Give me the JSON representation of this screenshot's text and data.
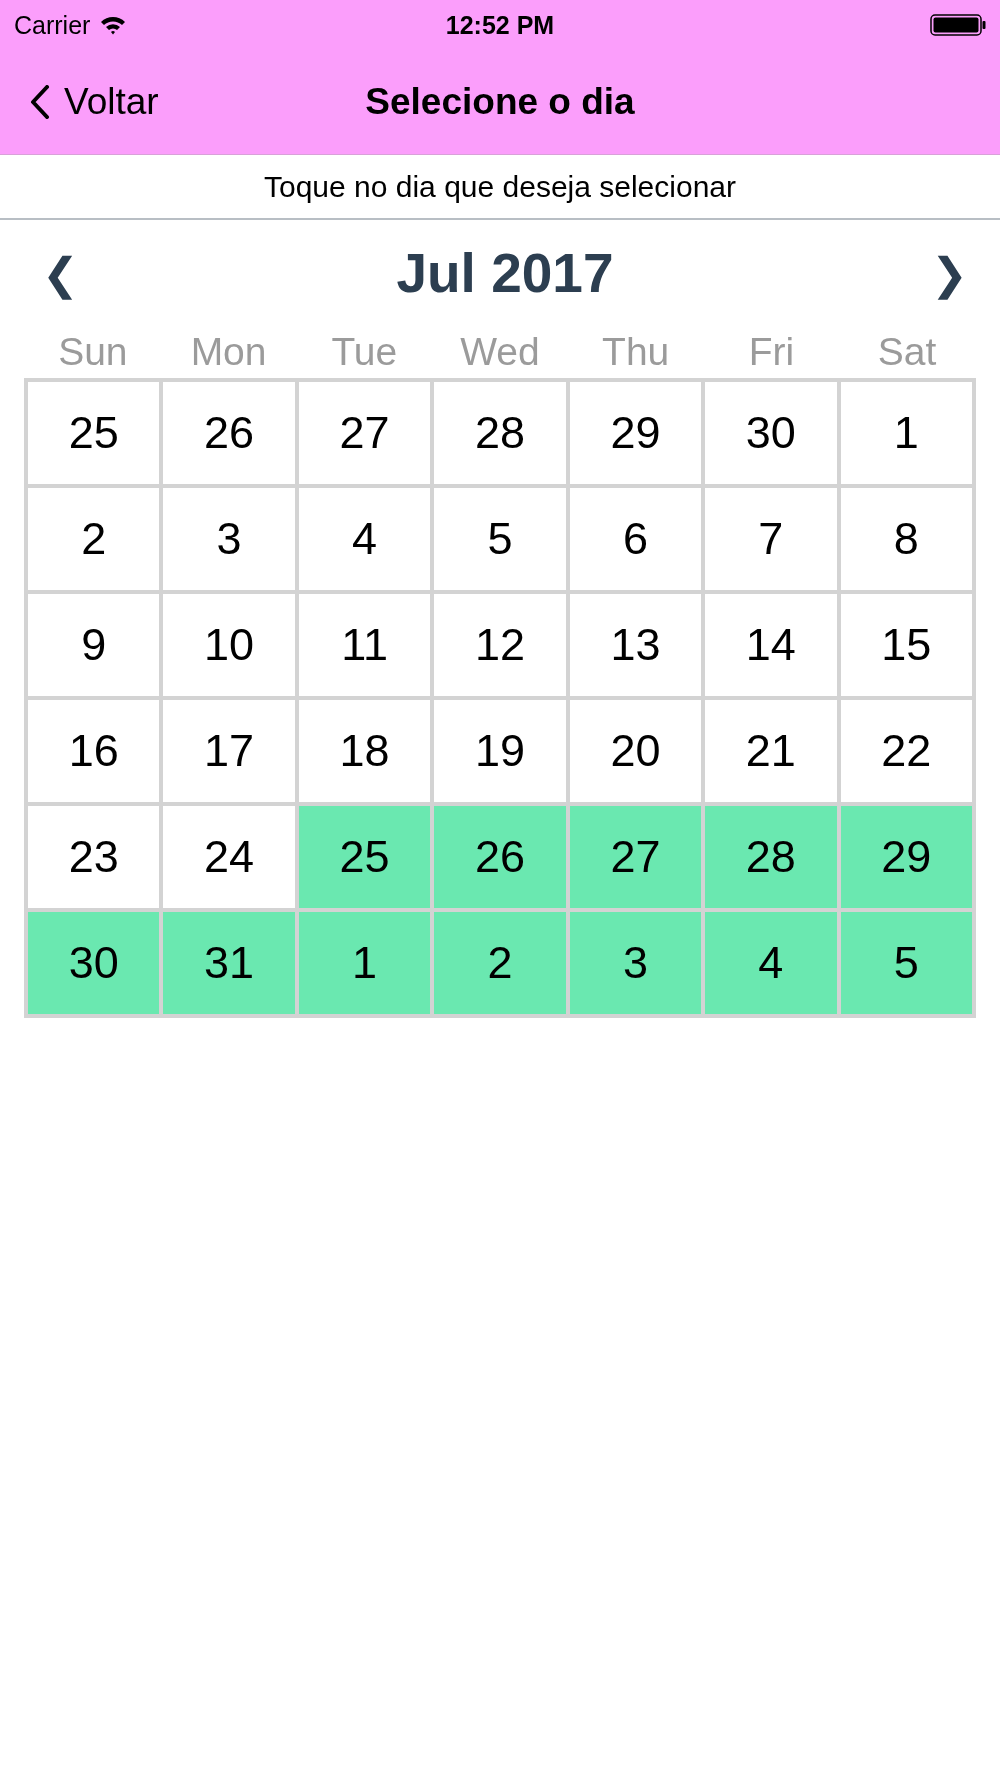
{
  "status_bar": {
    "carrier": "Carrier",
    "time": "12:52 PM"
  },
  "nav_bar": {
    "back": "Voltar",
    "title": "Selecione o dia"
  },
  "instruction": "Toque no dia que deseja selecionar",
  "calendar": {
    "prev": "❮",
    "next": "❯",
    "month": "Jul 2017",
    "weekdays": [
      "Sun",
      "Mon",
      "Tue",
      "Wed",
      "Thu",
      "Fri",
      "Sat"
    ],
    "days": [
      {
        "label": "25",
        "selected": false
      },
      {
        "label": "26",
        "selected": false
      },
      {
        "label": "27",
        "selected": false
      },
      {
        "label": "28",
        "selected": false
      },
      {
        "label": "29",
        "selected": false
      },
      {
        "label": "30",
        "selected": false
      },
      {
        "label": "1",
        "selected": false
      },
      {
        "label": "2",
        "selected": false
      },
      {
        "label": "3",
        "selected": false
      },
      {
        "label": "4",
        "selected": false
      },
      {
        "label": "5",
        "selected": false
      },
      {
        "label": "6",
        "selected": false
      },
      {
        "label": "7",
        "selected": false
      },
      {
        "label": "8",
        "selected": false
      },
      {
        "label": "9",
        "selected": false
      },
      {
        "label": "10",
        "selected": false
      },
      {
        "label": "11",
        "selected": false
      },
      {
        "label": "12",
        "selected": false
      },
      {
        "label": "13",
        "selected": false
      },
      {
        "label": "14",
        "selected": false
      },
      {
        "label": "15",
        "selected": false
      },
      {
        "label": "16",
        "selected": false
      },
      {
        "label": "17",
        "selected": false
      },
      {
        "label": "18",
        "selected": false
      },
      {
        "label": "19",
        "selected": false
      },
      {
        "label": "20",
        "selected": false
      },
      {
        "label": "21",
        "selected": false
      },
      {
        "label": "22",
        "selected": false
      },
      {
        "label": "23",
        "selected": false
      },
      {
        "label": "24",
        "selected": false
      },
      {
        "label": "25",
        "selected": true
      },
      {
        "label": "26",
        "selected": true
      },
      {
        "label": "27",
        "selected": true
      },
      {
        "label": "28",
        "selected": true
      },
      {
        "label": "29",
        "selected": true
      },
      {
        "label": "30",
        "selected": true
      },
      {
        "label": "31",
        "selected": true
      },
      {
        "label": "1",
        "selected": true
      },
      {
        "label": "2",
        "selected": true
      },
      {
        "label": "3",
        "selected": true
      },
      {
        "label": "4",
        "selected": true
      },
      {
        "label": "5",
        "selected": true
      }
    ]
  }
}
